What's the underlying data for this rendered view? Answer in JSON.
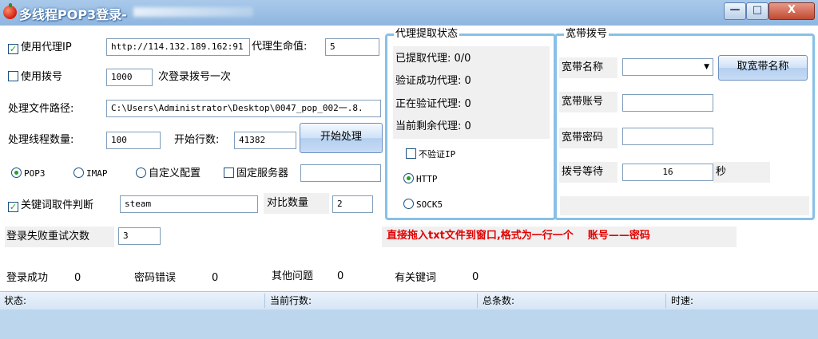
{
  "window": {
    "title": "多线程POP3登录-",
    "controls": {
      "minimize": "—",
      "maximize": "□",
      "close": "X"
    }
  },
  "proxy": {
    "use_proxy_label": "使用代理IP",
    "use_proxy_checked": true,
    "proxy_url": "http://114.132.189.162:91",
    "lifetime_label": "代理生命值:",
    "lifetime_value": "5"
  },
  "dial": {
    "use_dial_label": "使用拨号",
    "use_dial_checked": false,
    "per_count_value": "1000",
    "per_count_suffix": "次登录拨号一次"
  },
  "file": {
    "path_label": "处理文件路径:",
    "path_value": "C:\\Users\\Administrator\\Desktop\\0047_pop_002一.8."
  },
  "threads": {
    "label": "处理线程数量:",
    "value": "100",
    "start_row_label": "开始行数:",
    "start_row_value": "41382",
    "start_button": "开始处理"
  },
  "protocol": {
    "pop3": "POP3",
    "imap": "IMAP",
    "custom": "自定义配置",
    "fixed_server_label": "固定服务器",
    "fixed_server_value": "",
    "selected": "POP3"
  },
  "keyword": {
    "label": "关键词取件判断",
    "checked": true,
    "value": "steam",
    "compare_label": "对比数量",
    "compare_value": "2"
  },
  "retry": {
    "label": "登录失败重试次数",
    "value": "3"
  },
  "hint": "直接拖入txt文件到窗口,格式为一行一个    账号——密码",
  "proxy_status": {
    "legend": "代理提取状态",
    "extracted": "已提取代理: 0/0",
    "verified_ok": "验证成功代理: 0",
    "verifying": "正在验证代理: 0",
    "remaining": "当前剩余代理: 0",
    "no_verify_label": "不验证IP",
    "no_verify_checked": false,
    "http": "HTTP",
    "socks5": "SOCK5",
    "selected": "HTTP"
  },
  "broadband": {
    "legend": "宽带拨号",
    "name_label": "宽带名称",
    "name_value": "",
    "fetch_button": "取宽带名称",
    "account_label": "宽带账号",
    "account_value": "",
    "password_label": "宽带密码",
    "password_value": "",
    "wait_label": "拨号等待",
    "wait_value": "16",
    "wait_unit": "秒"
  },
  "stats": {
    "success_label": "登录成功",
    "success_value": "0",
    "pwd_error_label": "密码错误",
    "pwd_error_value": "0",
    "other_label": "其他问题",
    "other_value": "0",
    "keyword_label": "有关键词",
    "keyword_value": "0"
  },
  "statusbar": {
    "status": "状态:",
    "current_row": "当前行数:",
    "total": "总条数:",
    "speed": "时速:"
  },
  "colors": {
    "hint_red": "#e00000",
    "group_border": "#87c0e8",
    "check_green": "#21a121"
  }
}
